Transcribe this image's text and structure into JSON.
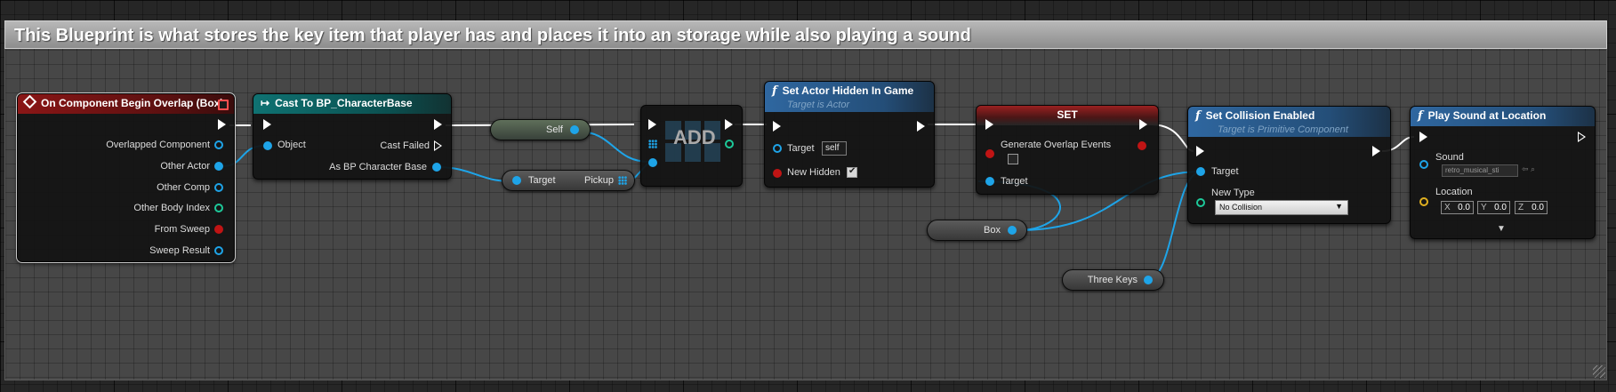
{
  "comment": {
    "text": "This Blueprint is what stores the key item that player has and places it into an storage while also playing a sound"
  },
  "event_node": {
    "title": "On Component Begin Overlap (Box)",
    "pins": [
      "Overlapped Component",
      "Other Actor",
      "Other Comp",
      "Other Body Index",
      "From Sweep",
      "Sweep Result"
    ]
  },
  "cast_node": {
    "title": "Cast To BP_CharacterBase",
    "object_label": "Object",
    "cast_failed_label": "Cast Failed",
    "as_label": "As BP Character Base"
  },
  "self_node": {
    "label": "Self"
  },
  "pickup_node": {
    "target_label": "Target",
    "value_label": "Pickup"
  },
  "add_node": {
    "label": "ADD"
  },
  "hidden_node": {
    "title": "Set Actor Hidden In Game",
    "subtitle": "Target is Actor",
    "target_label": "Target",
    "target_value": "self",
    "new_hidden_label": "New Hidden",
    "new_hidden_checked": true
  },
  "set_node": {
    "title": "SET",
    "overlap_label": "Generate Overlap Events",
    "overlap_checked": false,
    "target_label": "Target"
  },
  "box_node": {
    "label": "Box"
  },
  "three_keys_node": {
    "label": "Three Keys"
  },
  "collision_node": {
    "title": "Set Collision Enabled",
    "subtitle": "Target is Primitive Component",
    "target_label": "Target",
    "new_type_label": "New Type",
    "new_type_value": "No Collision"
  },
  "sound_node": {
    "title": "Play Sound at Location",
    "sound_label": "Sound",
    "sound_value": "retro_musical_sti",
    "location_label": "Location",
    "x_label": "X",
    "x_value": "0.0",
    "y_label": "Y",
    "y_value": "0.0",
    "z_label": "Z",
    "z_value": "0.0",
    "expand_glyph": "▼"
  },
  "function_glyph": "f",
  "colors": {
    "object_pin": "#1ea4e8",
    "int_pin": "#1dc99a",
    "bool_pin": "#c01414",
    "vector_pin": "#e0b020",
    "event_header": "#8a1616",
    "cast_header": "#0f7272",
    "function_header": "#2f67a0"
  }
}
